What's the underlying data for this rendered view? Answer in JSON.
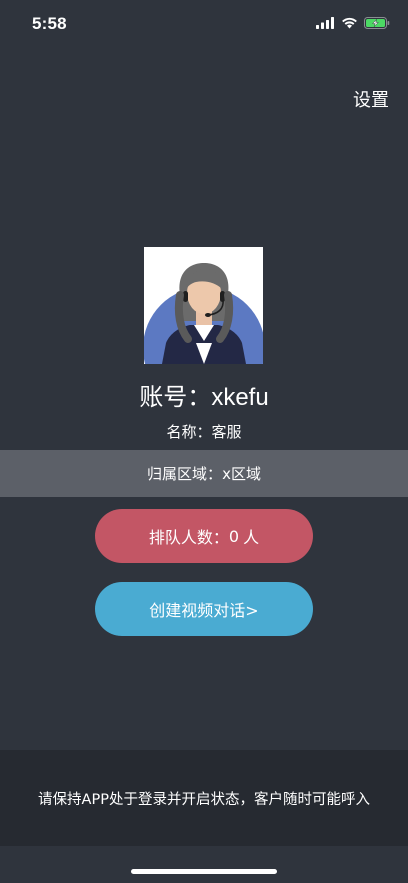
{
  "status_bar": {
    "time": "5:58",
    "icons": [
      "signal-icon",
      "wifi-icon",
      "battery-charging-icon"
    ]
  },
  "header": {
    "settings_label": "设置"
  },
  "profile": {
    "avatar_icon": "customer-service-agent-avatar",
    "account_label": "账号：",
    "account_value": "xkefu",
    "name_label": "名称：",
    "name_value": "客服",
    "region_label": "归属区域：",
    "region_value": "x区域"
  },
  "actions": {
    "queue_label": "排队人数：",
    "queue_count": "0",
    "queue_unit": "人",
    "create_video_label": "创建视频对话>"
  },
  "notice": {
    "text": "请保持APP处于登录并开启状态，客户随时可能呼入"
  },
  "colors": {
    "background": "#2f343d",
    "region_band": "#5c6068",
    "queue_button": "#c35665",
    "video_button": "#4aabd2",
    "notice_band": "#262a31",
    "battery_green": "#4cd964"
  }
}
